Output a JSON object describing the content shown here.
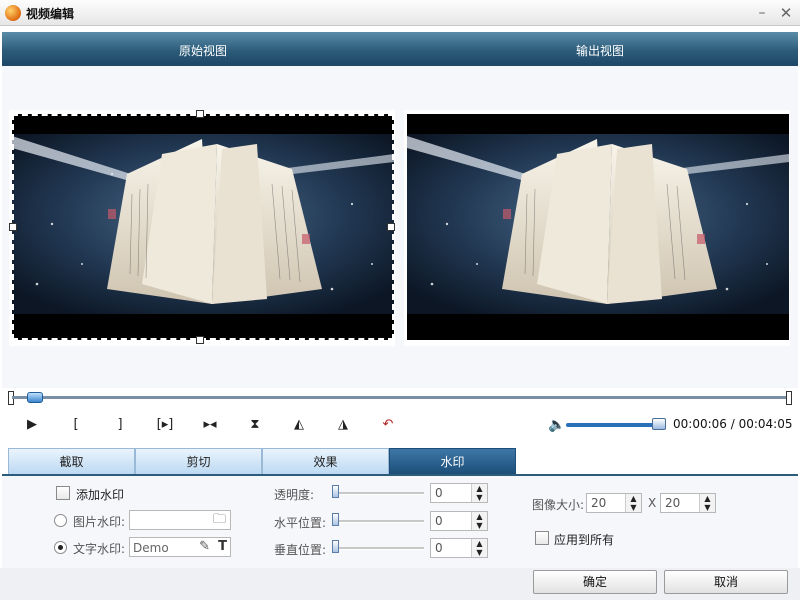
{
  "window": {
    "title": "视频编辑",
    "minimize_glyph": "–",
    "close_glyph": "✕"
  },
  "views": {
    "original_label": "原始视图",
    "output_label": "输出视图"
  },
  "playback": {
    "position_fraction": 0.024,
    "volume_fraction": 0.9,
    "time": "00:00:06 / 00:04:05",
    "buttons": [
      "play-icon",
      "mark-in-icon",
      "mark-out-icon",
      "split-icon",
      "next-frame-icon",
      "crop-vertical-icon",
      "flip-icon",
      "mirror-icon",
      "undo-icon"
    ]
  },
  "tabs": [
    {
      "label": "截取",
      "active": false
    },
    {
      "label": "剪切",
      "active": false
    },
    {
      "label": "效果",
      "active": false
    },
    {
      "label": "水印",
      "active": true
    }
  ],
  "watermark": {
    "enable_label": "添加水印",
    "image_label": "图片水印:",
    "image_path": "",
    "text_label": "文字水印:",
    "text_value": "Demo",
    "text_mode_selected": true,
    "transparency_label": "透明度:",
    "transparency_value": "0",
    "horizontal_label": "水平位置:",
    "horizontal_value": "0",
    "vertical_label": "垂直位置:",
    "vertical_value": "0",
    "image_size_label": "图像大小:",
    "width_value": "20",
    "size_separator": "X",
    "height_value": "20",
    "apply_all_label": "应用到所有"
  },
  "footer": {
    "ok_label": "确定",
    "cancel_label": "取消"
  },
  "colors": {
    "header_blue": "#2c5c7a",
    "active_tab": "#1c4e78",
    "accent_blue": "#2a6fba"
  }
}
